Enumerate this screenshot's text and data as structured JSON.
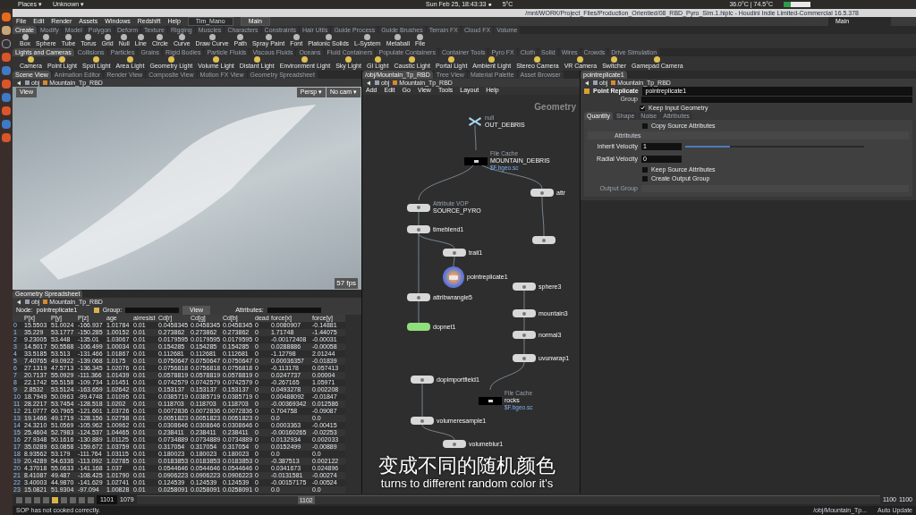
{
  "top_bar": {
    "places": "Places ▾",
    "app": "Unknown ▾",
    "clock": "Sun Feb 25, 18:43:33 ●",
    "weather": "5°C",
    "temps": "36.0°C | 74.5°C"
  },
  "window": {
    "title": "/mnt/WORK/Project_Files/Production_Orientied/08_RBD_Pyro_Sim.1.hiplc - Houdini Indie Limited-Commercial 16.5.378"
  },
  "menu": [
    "File",
    "Edit",
    "Render",
    "Assets",
    "Windows",
    "Redshift",
    "Help"
  ],
  "desktops": [
    {
      "label": "Tim_Mano",
      "selected": false
    },
    {
      "label": "Main",
      "selected": true
    }
  ],
  "desktop_select": "Main",
  "shelf_tabs": [
    {
      "label": "Create",
      "selected": true
    },
    {
      "label": "Modify",
      "selected": false
    },
    {
      "label": "Model",
      "selected": false
    },
    {
      "label": "Polygon",
      "selected": false
    },
    {
      "label": "Deform",
      "selected": false
    },
    {
      "label": "Texture",
      "selected": false
    },
    {
      "label": "Rigging",
      "selected": false
    },
    {
      "label": "Muscles",
      "selected": false
    },
    {
      "label": "Characters",
      "selected": false
    },
    {
      "label": "Constraints",
      "selected": false
    },
    {
      "label": "Hair Utils",
      "selected": false
    },
    {
      "label": "Guide Process",
      "selected": false
    },
    {
      "label": "Guide Brushes",
      "selected": false
    },
    {
      "label": "Terrain FX",
      "selected": false
    },
    {
      "label": "Cloud FX",
      "selected": false
    },
    {
      "label": "Volume",
      "selected": false
    }
  ],
  "shelf_tools": [
    "Box",
    "Sphere",
    "Tube",
    "Torus",
    "Grid",
    "Null",
    "Line",
    "Circle",
    "Curve",
    "Draw Curve",
    "Path",
    "Spray Paint",
    "Font",
    "Platonic Solids",
    "L-System",
    "Metaball",
    "File"
  ],
  "dyn_shelf_tabs": [
    {
      "label": "Lights and Cameras",
      "selected": true
    },
    {
      "label": "Collisions",
      "selected": false
    },
    {
      "label": "Particles",
      "selected": false
    },
    {
      "label": "Grains",
      "selected": false
    },
    {
      "label": "Rigid Bodies",
      "selected": false
    },
    {
      "label": "Particle Fluids",
      "selected": false
    },
    {
      "label": "Viscous Fluids",
      "selected": false
    },
    {
      "label": "Oceans",
      "selected": false
    },
    {
      "label": "Fluid Containers",
      "selected": false
    },
    {
      "label": "Populate Containers",
      "selected": false
    },
    {
      "label": "Container Tools",
      "selected": false
    },
    {
      "label": "Pyro FX",
      "selected": false
    },
    {
      "label": "Cloth",
      "selected": false
    },
    {
      "label": "Solid",
      "selected": false
    },
    {
      "label": "Wires",
      "selected": false
    },
    {
      "label": "Crowds",
      "selected": false
    },
    {
      "label": "Drive Simulation",
      "selected": false
    }
  ],
  "dyn_shelf_tools": [
    "Camera",
    "Point Light",
    "Spot Light",
    "Area Light",
    "Geometry Light",
    "Volume Light",
    "Distant Light",
    "Environment Light",
    "Sky Light",
    "GI Light",
    "Caustic Light",
    "Portal Light",
    "Ambient Light",
    "Stereo Camera",
    "VR Camera",
    "Switcher",
    "Gamepad Camera"
  ],
  "left_pane": {
    "tabs": [
      {
        "label": "Scene View",
        "selected": true
      },
      {
        "label": "Animation Editor",
        "selected": false
      },
      {
        "label": "Render View",
        "selected": false
      },
      {
        "label": "Composite View",
        "selected": false
      },
      {
        "label": "Motion FX View",
        "selected": false
      },
      {
        "label": "Geometry Spreadsheet",
        "selected": false
      }
    ],
    "path": [
      "obj",
      "Mountain_Tp_RBD"
    ]
  },
  "viewport": {
    "label": "View",
    "camera": "Persp ▾",
    "cam_select": "No cam ▾",
    "fps": "57 fps"
  },
  "spreadsheet": {
    "tab": "Geometry Spreadsheet",
    "path": [
      "obj",
      "Mountain_Tp_RBD"
    ],
    "node_label": "Node:",
    "node": "pointreplicate1",
    "group_label": "Group:",
    "view": "View",
    "attributes_label": "Attributes:",
    "columns": [
      "",
      "P[x]",
      "P[y]",
      "P[z]",
      "age",
      "airresist",
      "Cd[r]",
      "Cd[g]",
      "Cd[b]",
      "dead",
      "force[x]",
      "force[y]"
    ],
    "rows": [
      [
        "0",
        "15.5503",
        "51.0024",
        "-166.937",
        "1.01784",
        "0.01",
        "0.0458345",
        "0.0458345",
        "0.0458345",
        "0",
        "0.0080907",
        "-0.14881"
      ],
      [
        "1",
        "35.229",
        "53.1777",
        "-150.285",
        "1.00152",
        "0.01",
        "0.273862",
        "0.273862",
        "0.273862",
        "0",
        "1.71748",
        "-1.44075"
      ],
      [
        "2",
        "9.23005",
        "53.448",
        "-135.01",
        "1.03067",
        "0.01",
        "0.0179595",
        "0.0179595",
        "0.0179595",
        "0",
        "-0.00172408",
        "-0.00031"
      ],
      [
        "3",
        "14.5017",
        "50.5588",
        "-106.499",
        "1.00034",
        "0.01",
        "0.154285",
        "0.154285",
        "0.154285",
        "0",
        "0.0288886",
        "-0.00058"
      ],
      [
        "4",
        "33.5185",
        "53.513",
        "-131.466",
        "1.01867",
        "0.01",
        "0.112681",
        "0.112681",
        "0.112681",
        "0",
        "-1.12798",
        "2.01244"
      ],
      [
        "5",
        "7.40765",
        "49.0922",
        "-139.068",
        "1.0175",
        "0.01",
        "0.0750647",
        "0.0750647",
        "0.0750647",
        "0",
        "0.00036357",
        "-0.01839"
      ],
      [
        "6",
        "27.1319",
        "47.5713",
        "-136.345",
        "1.02076",
        "0.01",
        "0.0756818",
        "0.0756818",
        "0.0756818",
        "0",
        "-0.113178",
        "0.057413"
      ],
      [
        "7",
        "20.7137",
        "55.0929",
        "-111.366",
        "1.01439",
        "0.01",
        "0.0578819",
        "0.0578819",
        "0.0578819",
        "0",
        "0.0247737",
        "0.00004"
      ],
      [
        "8",
        "22.1742",
        "55.5158",
        "-109.734",
        "1.01451",
        "0.01",
        "0.0742579",
        "0.0742579",
        "0.0742579",
        "0",
        "-0.267165",
        "1.05971"
      ],
      [
        "9",
        "2.8532",
        "53.5124",
        "-163.659",
        "1.02642",
        "0.01",
        "0.153137",
        "0.153137",
        "0.153137",
        "0",
        "0.0493278",
        "0.002208"
      ],
      [
        "10",
        "18.7949",
        "50.0963",
        "-99.4748",
        "1.01095",
        "0.01",
        "0.0385719",
        "0.0385719",
        "0.0385719",
        "0",
        "0.00488092",
        "-0.01847"
      ],
      [
        "11",
        "28.2217",
        "53.7454",
        "-128.518",
        "1.0202",
        "0.01",
        "0.118703",
        "0.118703",
        "0.118703",
        "0",
        "-0.00369342",
        "0.012586"
      ],
      [
        "12",
        "21.0777",
        "60.7965",
        "-121.601",
        "1.03726",
        "0.01",
        "0.0072836",
        "0.0072836",
        "0.0072836",
        "0",
        "0.704758",
        "-0.09087"
      ],
      [
        "13",
        "19.1466",
        "49.1719",
        "-128.156",
        "1.02758",
        "0.01",
        "0.0051823",
        "0.0051823",
        "0.0051823",
        "0",
        "0.0",
        "0.0"
      ],
      [
        "14",
        "24.3210",
        "51.0569",
        "-105.962",
        "1.00962",
        "0.01",
        "0.0308646",
        "0.0308646",
        "0.0308646",
        "0",
        "0.0003363",
        "-0.00415"
      ],
      [
        "15",
        "25.4604",
        "52.7983",
        "-124.537",
        "1.04465",
        "0.01",
        "0.238411",
        "0.238411",
        "0.238411",
        "0",
        "-0.00160265",
        "-0.02253"
      ],
      [
        "16",
        "27.9348",
        "50.1616",
        "-130.889",
        "1.01125",
        "0.01",
        "0.0734889",
        "0.0734889",
        "0.0734889",
        "0",
        "0.0132934",
        "0.002033"
      ],
      [
        "17",
        "35.0289",
        "63.0858",
        "-159.672",
        "1.03759",
        "0.01",
        "0.317054",
        "0.317054",
        "0.317054",
        "0",
        "0.0152499",
        "-0.00889"
      ],
      [
        "18",
        "8.93562",
        "53.179",
        "-111.764",
        "1.03115",
        "0.01",
        "0.180023",
        "0.180023",
        "0.180023",
        "0",
        "0.0",
        "0.0"
      ],
      [
        "19",
        "20.4289",
        "54.6336",
        "-113.092",
        "1.02785",
        "0.01",
        "0.0183853",
        "0.0183853",
        "0.0183853",
        "0",
        "-0.387513",
        "0.002122"
      ],
      [
        "20",
        "4.37018",
        "55.0633",
        "-141.168",
        "1.037",
        "0.01",
        "0.0544646",
        "0.0544646",
        "0.0544646",
        "0",
        "0.0341673",
        "0.024896"
      ],
      [
        "21",
        "8.41087",
        "49.487",
        "-108.425",
        "1.01790",
        "0.01",
        "0.0906223",
        "0.0906223",
        "0.0906223",
        "0",
        "-0.0131581",
        "-0.00274"
      ],
      [
        "22",
        "3.40003",
        "44.9870",
        "-141.629",
        "1.02741",
        "0.01",
        "0.124539",
        "0.124539",
        "0.124539",
        "0",
        "-0.00157175",
        "-0.00524"
      ],
      [
        "23",
        "15.0821",
        "51.9304",
        "-97.094",
        "1.00828",
        "0.01",
        "0.0258091",
        "0.0258091",
        "0.0258091",
        "0",
        "0.0",
        "0.0"
      ]
    ]
  },
  "network": {
    "tabs": [
      {
        "label": "/obj/Mountain_Tp_RBD",
        "selected": true
      },
      {
        "label": "Tree View",
        "selected": false
      },
      {
        "label": "Material Palette",
        "selected": false
      },
      {
        "label": "Asset Browser",
        "selected": false
      }
    ],
    "path": [
      "obj",
      "Mountain_Tp_RBD"
    ],
    "menu": [
      "Add",
      "Edit",
      "Go",
      "View",
      "Tools",
      "Layout",
      "Help"
    ],
    "context": "Geometry",
    "nodes": [
      {
        "kind": "null",
        "type_label": "null",
        "name": "OUT_DEBRIS",
        "selected": false
      },
      {
        "kind": "filecache",
        "type_label": "File Cache",
        "name": "MOUNTAIN_DEBRIS",
        "file": "$F.bgeo.sc",
        "selected": false
      },
      {
        "kind": "sop",
        "type_label": "Attribute VOP",
        "name": "SOURCE_PYRO",
        "selected": false
      },
      {
        "kind": "sop",
        "name": "timeblend1",
        "selected": false
      },
      {
        "kind": "sop",
        "name": "trail1",
        "selected": false
      },
      {
        "kind": "sop",
        "name": "pointreplicate1",
        "selected": true
      },
      {
        "kind": "sop",
        "name": "attr",
        "selected": false
      },
      {
        "kind": "sop",
        "selected": false
      },
      {
        "kind": "sop",
        "name": "attribwrangle5",
        "selected": false
      },
      {
        "kind": "sop",
        "name": "sphere3",
        "selected": false
      },
      {
        "kind": "dopnet",
        "name": "dopnet1",
        "selected": false
      },
      {
        "kind": "sop",
        "name": "mountain3",
        "selected": false
      },
      {
        "kind": "sop",
        "name": "normal3",
        "selected": false
      },
      {
        "kind": "sop",
        "name": "uvunwrap1",
        "selected": false
      },
      {
        "kind": "sop",
        "name": "dopimportfield1",
        "selected": false
      },
      {
        "kind": "filecache",
        "type_label": "File Cache",
        "name": "rocks",
        "file": "$F.bgeo.sc",
        "selected": false
      },
      {
        "kind": "sop",
        "name": "volumeresample1",
        "selected": false
      },
      {
        "kind": "sop",
        "name": "volumeblur1",
        "selected": false
      }
    ]
  },
  "parameters": {
    "tab": "pointreplicate1",
    "path": [
      "obj",
      "Mountain_Tp_RBD"
    ],
    "node_type": "Point Replicate",
    "node_name": "pointreplicate1",
    "group_label": "Group",
    "keep_input": {
      "label": "Keep Input Geometry",
      "checked": true
    },
    "tabs": [
      {
        "label": "Quantity",
        "selected": true
      },
      {
        "label": "Shape",
        "selected": false
      },
      {
        "label": "Noise",
        "selected": false
      },
      {
        "label": "Attributes",
        "selected": false
      }
    ],
    "copy_source": {
      "label": "Copy Source Attributes",
      "checked": false
    },
    "section": "Attributes",
    "inherit": {
      "label": "Inherit Velocity",
      "value": "1",
      "level": 0.25
    },
    "radial": {
      "label": "Radial Velocity",
      "value": "0"
    },
    "keep_source": {
      "label": "Keep Source Attributes",
      "checked": false
    },
    "create_group": {
      "label": "Create Output Group",
      "checked": false
    },
    "output_group": "Output Group"
  },
  "playbar": {
    "frame": "1101",
    "start": "1079",
    "marker": "1102",
    "end_a": "1100",
    "end_b": "1100"
  },
  "status": {
    "message": "SOP has not cooked correctly.",
    "path": "/obj/Mountain_Tp...",
    "update": "Auto Update"
  },
  "subtitle": {
    "chinese": "变成不同的随机颜色",
    "english": "turns to different random color it's"
  }
}
